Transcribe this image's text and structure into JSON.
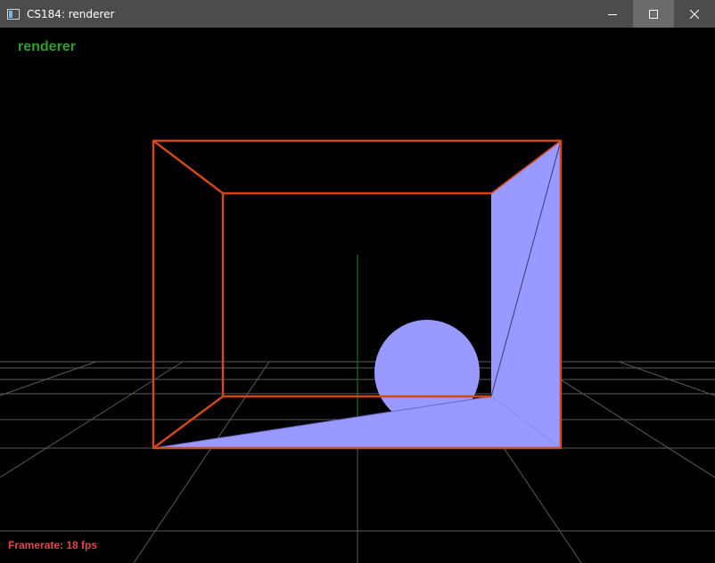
{
  "window": {
    "title": "CS184: renderer",
    "icon": "app-window-icon",
    "controls": {
      "minimize": "minimize-icon",
      "maximize": "maximize-icon",
      "close": "close-icon"
    }
  },
  "viewport": {
    "overlay_title": "renderer",
    "framerate_text": "Framerate: 18 fps",
    "colors": {
      "background": "#000000",
      "grid": "#5a5a5a",
      "box_edges": "#d0481e",
      "mesh_fill": "#9999ff",
      "axis": "#1f8a1f",
      "title_text": "#2f9e2f",
      "framerate_text": "#e04848"
    }
  }
}
